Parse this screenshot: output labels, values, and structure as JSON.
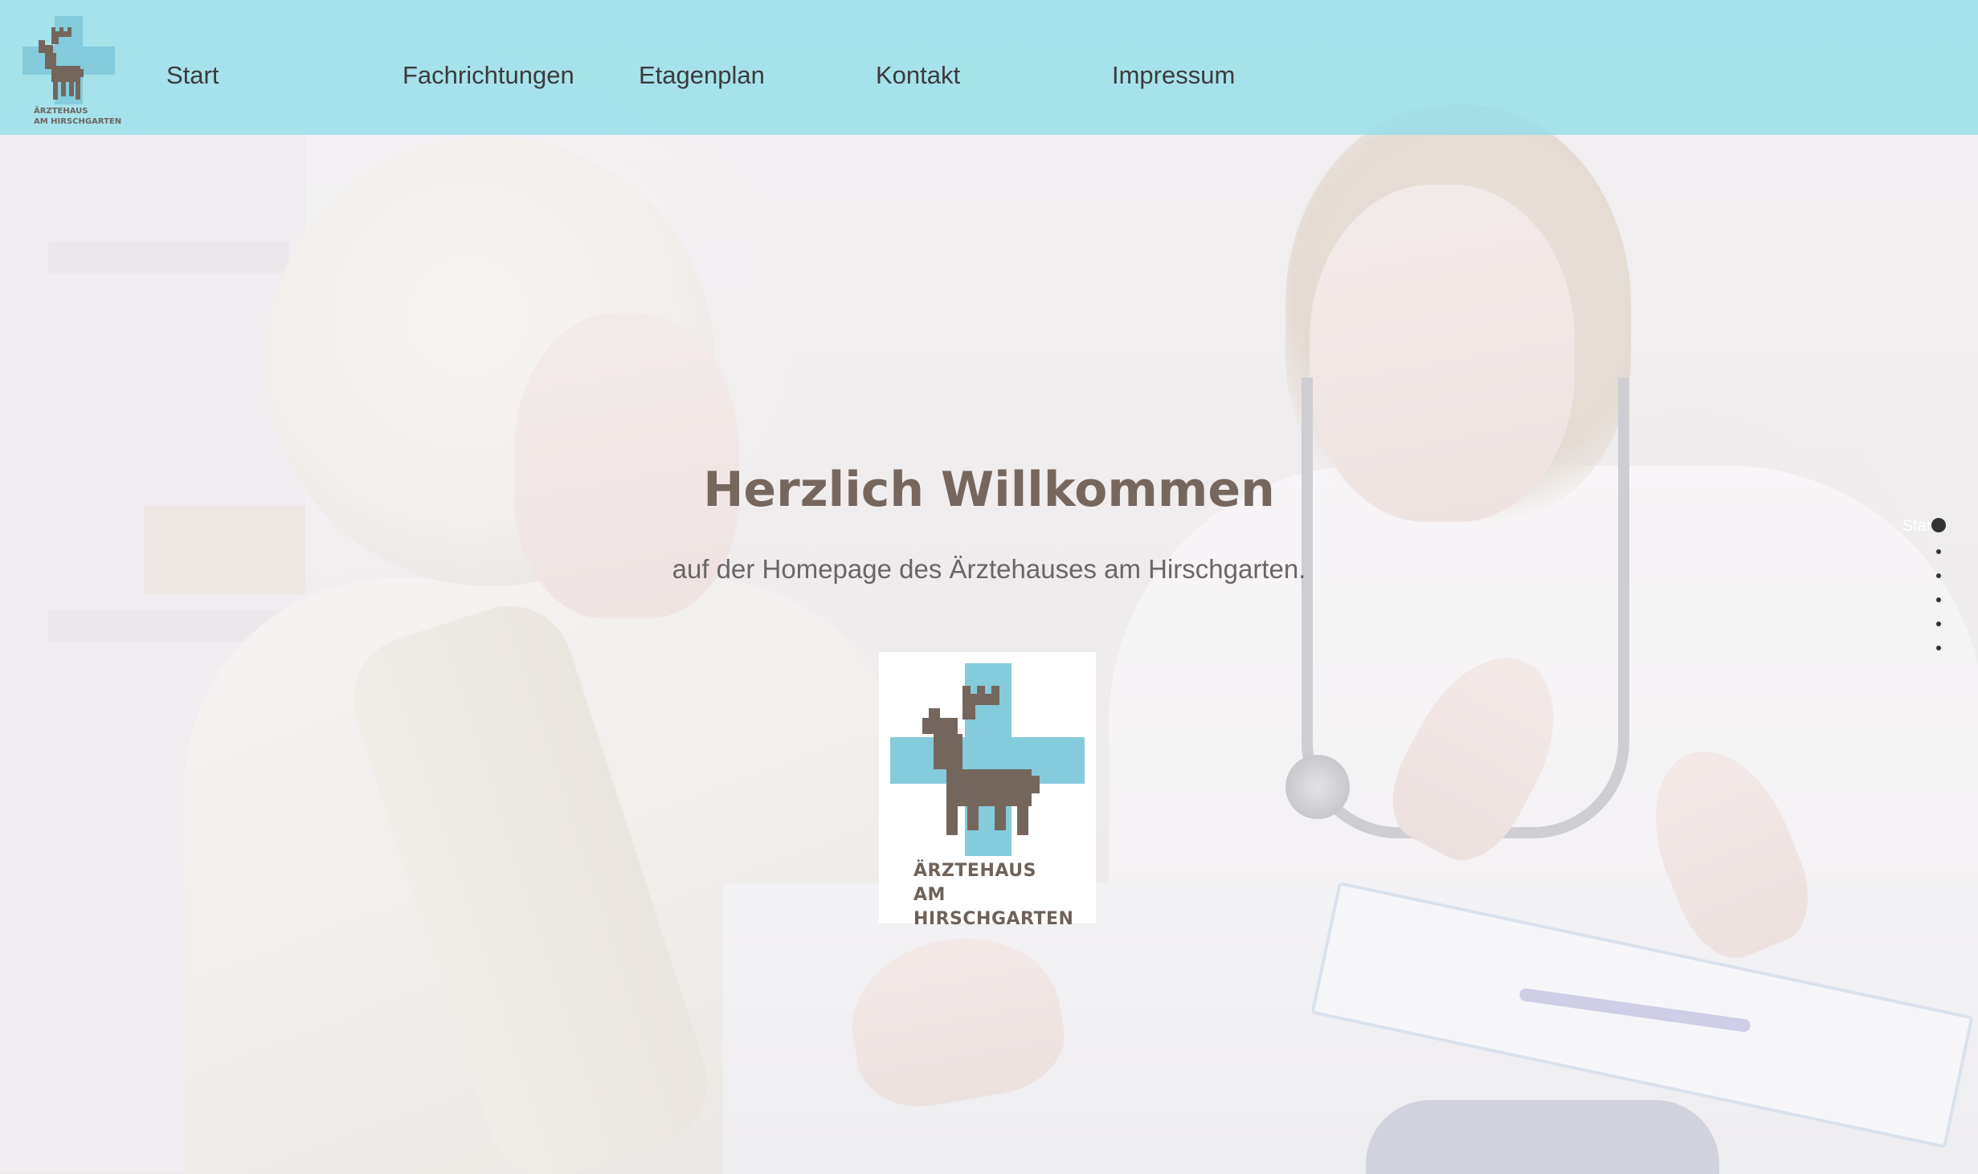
{
  "brand": {
    "name_line1": "ÄRZTEHAUS",
    "name_line2": "AM HIRSCHGARTEN",
    "colors": {
      "cross_blue": "#84cbdc",
      "deer_brown": "#75665d",
      "nav_bg": "#a5e2ea"
    }
  },
  "nav": {
    "items": [
      {
        "label": "Start"
      },
      {
        "label": "Fachrichtungen"
      },
      {
        "label": "Etagenplan"
      },
      {
        "label": "Kontakt"
      },
      {
        "label": "Impressum"
      }
    ]
  },
  "hero": {
    "title": "Herzlich Willkommen",
    "subtitle": "auf der Homepage des Ärztehauses am Hirschgarten."
  },
  "section_nav": {
    "active_label": "Start",
    "dot_count": 6,
    "active_index": 0
  }
}
